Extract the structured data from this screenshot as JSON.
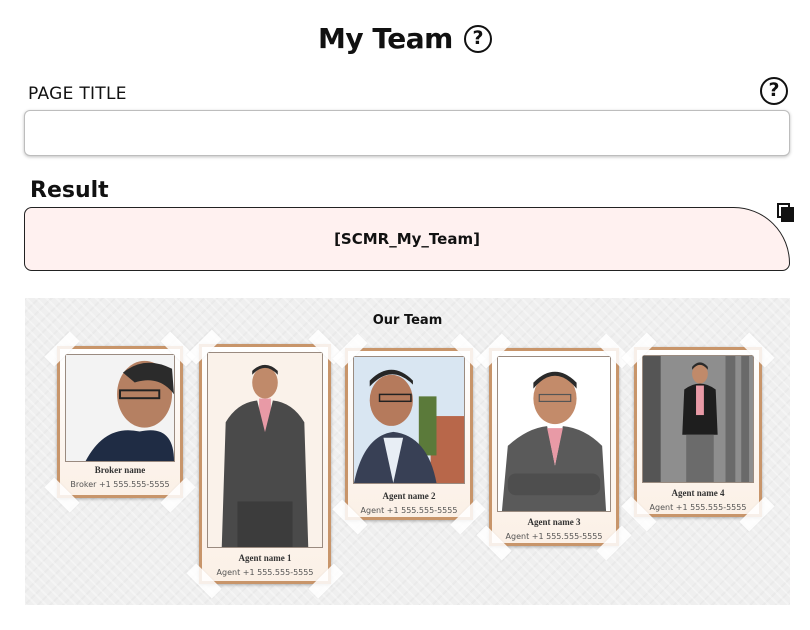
{
  "header": {
    "title": "My Team",
    "help_glyph": "?"
  },
  "page_title_field": {
    "label": "PAGE TITLE",
    "value": "",
    "help_glyph": "?"
  },
  "result": {
    "label": "Result",
    "shortcode": "[SCMR_My_Team]",
    "copy_icon": "copy-icon"
  },
  "preview": {
    "title": "Our Team",
    "members": [
      {
        "name": "Broker name",
        "phone": "Broker +1 555.555-5555"
      },
      {
        "name": "Agent name 1",
        "phone": "Agent +1 555.555-5555"
      },
      {
        "name": "Agent name 2",
        "phone": "Agent +1 555.555-5555"
      },
      {
        "name": "Agent name 3",
        "phone": "Agent +1 555.555-5555"
      },
      {
        "name": "Agent name 4",
        "phone": "Agent +1 555.555-5555"
      }
    ]
  },
  "colors": {
    "result_bg": "#fff1f0",
    "card_frame": "#c8956a",
    "preview_bg": "#efefef"
  }
}
